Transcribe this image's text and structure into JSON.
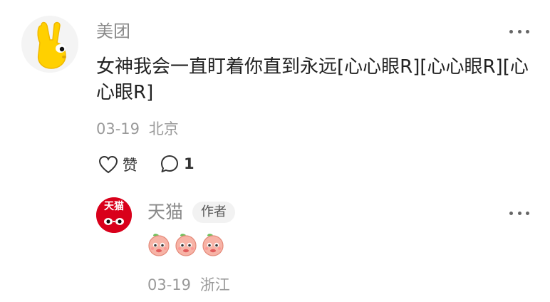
{
  "comment": {
    "user": {
      "name": "美团",
      "avatar": "meituan-logo"
    },
    "text": "女神我会一直盯着你直到永远[心心眼R][心心眼R][心心眼R]",
    "date": "03-19",
    "location": "北京",
    "like_label": "赞",
    "reply_count": "1"
  },
  "reply": {
    "user": {
      "name": "天猫",
      "avatar": "tmall-logo",
      "avatar_text": "天猫"
    },
    "author_badge": "作者",
    "emoji": [
      "peach-emoji",
      "peach-emoji",
      "peach-emoji"
    ],
    "date": "03-19",
    "location": "浙江"
  },
  "icons": {
    "more": "more-dots-icon",
    "like": "heart-outline-icon",
    "comment": "comment-bubble-icon"
  },
  "colors": {
    "text_primary": "#222222",
    "text_secondary": "#8a8a8a",
    "meta": "#9a9a9a",
    "meituan_yellow": "#ffd000",
    "tmall_red": "#d9001b",
    "peach_pink": "#f7b3a6"
  }
}
